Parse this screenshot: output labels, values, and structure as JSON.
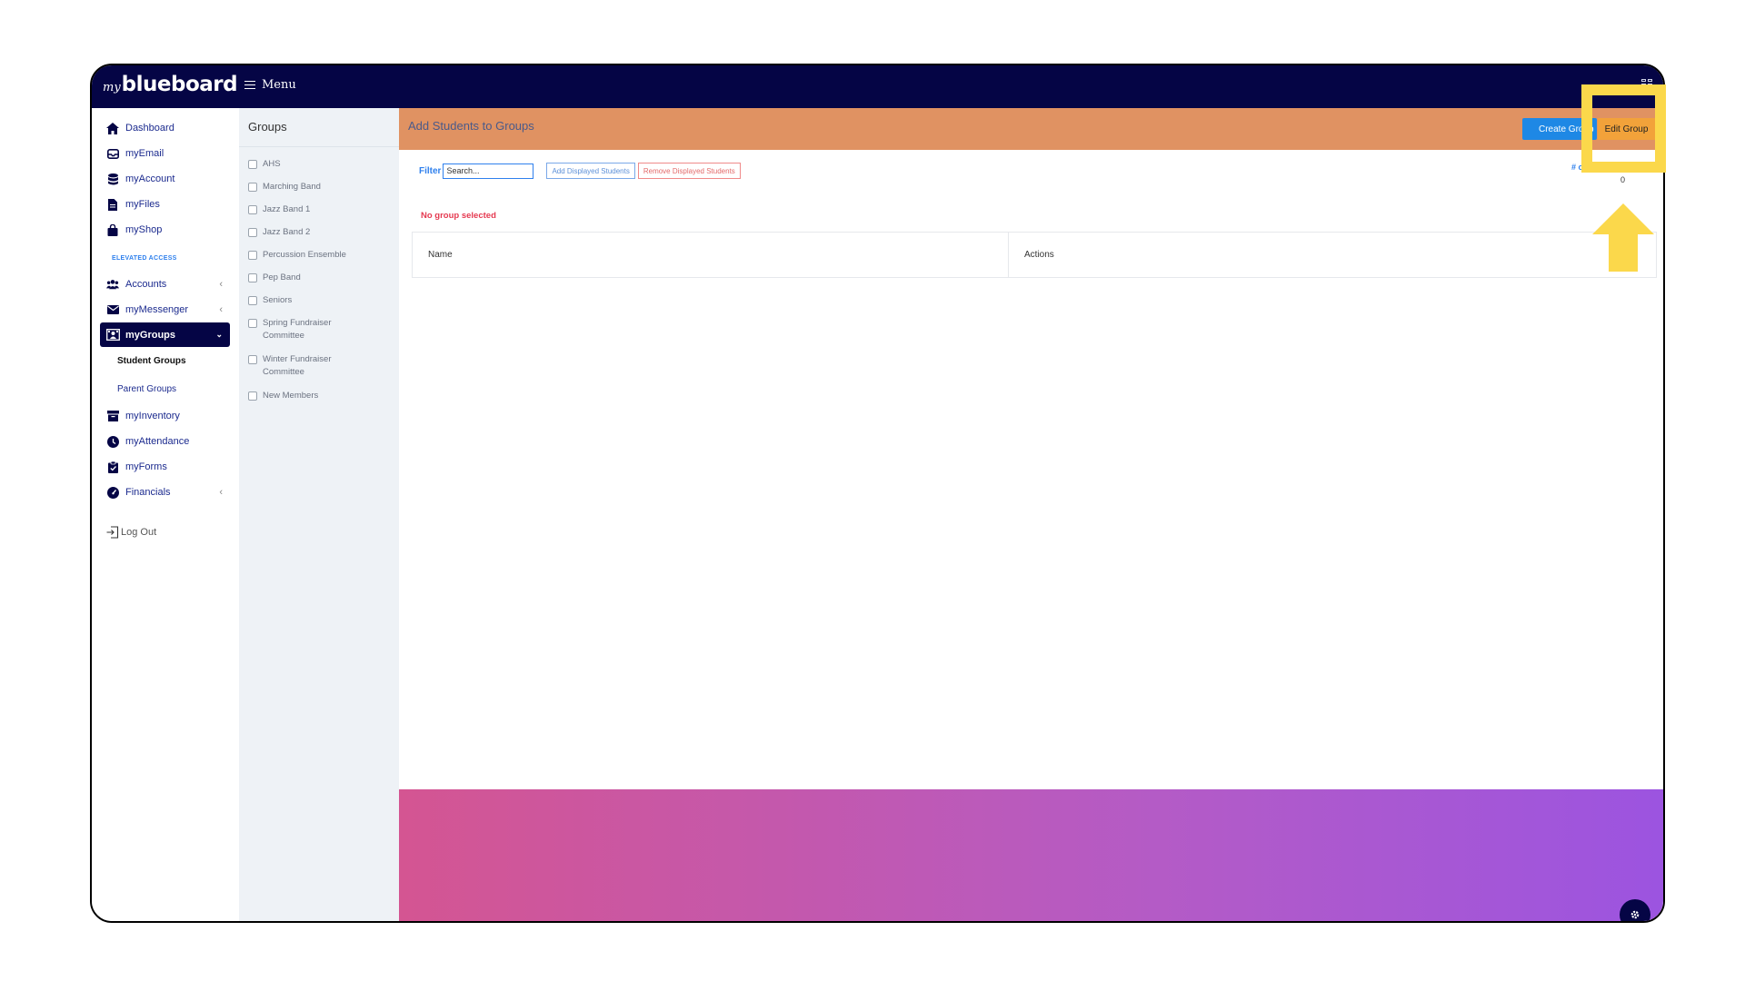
{
  "app": {
    "logo_my": "my",
    "logo_name": "blueboard",
    "menu_label": "Menu"
  },
  "sidebar": {
    "items": [
      {
        "label": "Dashboard",
        "icon": "home-icon"
      },
      {
        "label": "myEmail",
        "icon": "inbox-icon"
      },
      {
        "label": "myAccount",
        "icon": "database-icon"
      },
      {
        "label": "myFiles",
        "icon": "file-icon"
      },
      {
        "label": "myShop",
        "icon": "shopping-bag-icon"
      }
    ],
    "elevated_label": "ELEVATED ACCESS",
    "elevated_items": [
      {
        "label": "Accounts",
        "icon": "users-icon"
      },
      {
        "label": "myMessenger",
        "icon": "envelope-icon"
      },
      {
        "label": "myGroups",
        "icon": "group-icon"
      }
    ],
    "sub_items": [
      {
        "label": "Student Groups"
      },
      {
        "label": "Parent Groups"
      }
    ],
    "more_items": [
      {
        "label": "myInventory",
        "icon": "archive-icon"
      },
      {
        "label": "myAttendance",
        "icon": "clock-icon"
      },
      {
        "label": "myForms",
        "icon": "clipboard-check-icon"
      },
      {
        "label": "Financials",
        "icon": "tachometer-icon"
      }
    ],
    "logout_label": "Log Out"
  },
  "groups_panel": {
    "title": "Groups",
    "items": [
      {
        "label": "AHS"
      },
      {
        "label": "Marching Band"
      },
      {
        "label": "Jazz Band 1"
      },
      {
        "label": "Jazz Band 2"
      },
      {
        "label": "Percussion Ensemble"
      },
      {
        "label": "Pep Band"
      },
      {
        "label": "Seniors"
      },
      {
        "label": "Spring Fundraiser Committee"
      },
      {
        "label": "Winter Fundraiser Committee"
      },
      {
        "label": "New Members"
      }
    ]
  },
  "main": {
    "title": "Add Students to Groups",
    "create_button": "Create Group",
    "edit_button": "Edit Group",
    "filter_label": "Filter",
    "search_placeholder": "Search...",
    "add_displayed": "Add Displayed Students",
    "remove_displayed": "Remove Displayed Students",
    "count_label": "# o",
    "count_value": "0",
    "no_group": "No group selected",
    "table_headers": [
      "Name",
      "Actions"
    ]
  },
  "colors": {
    "navy": "#050545",
    "header_orange": "#e09262",
    "highlight_yellow": "#fbd84b",
    "primary_blue": "#1e88e5"
  }
}
